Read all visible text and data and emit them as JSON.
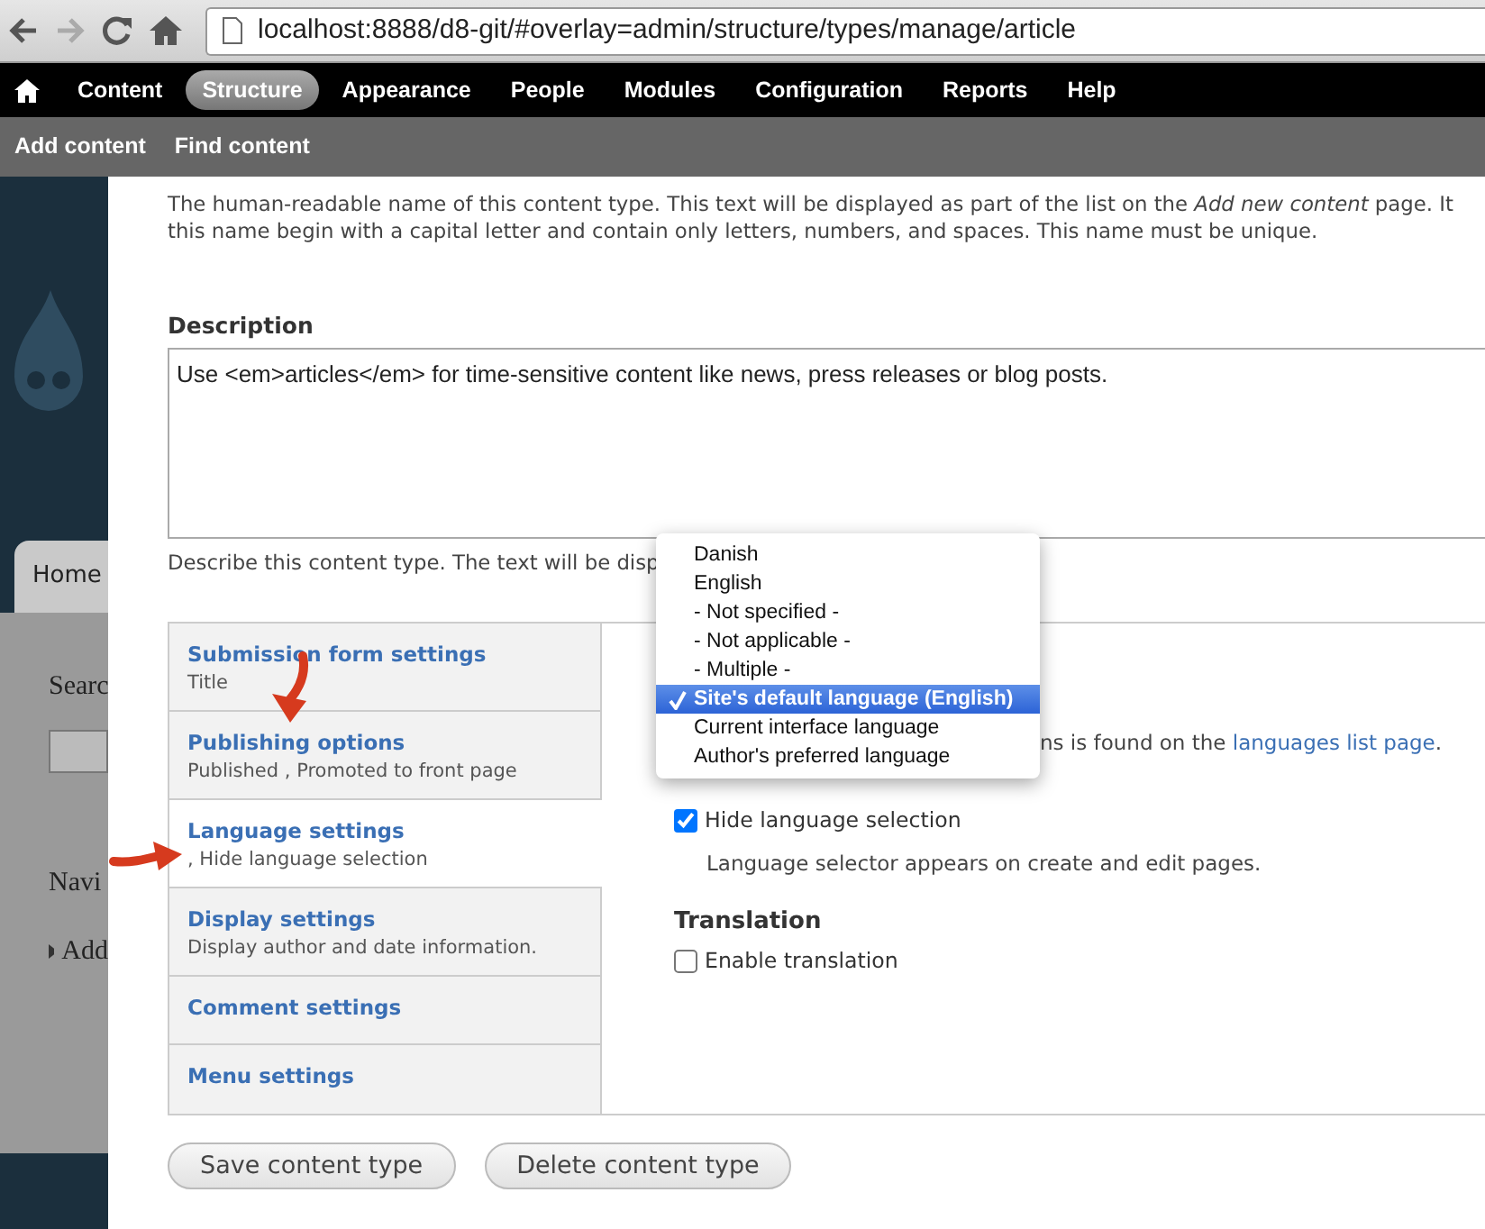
{
  "browser": {
    "url": "localhost:8888/d8-git/#overlay=admin/structure/types/manage/article"
  },
  "toolbar": [
    {
      "label": "Content",
      "selected": false
    },
    {
      "label": "Structure",
      "selected": true
    },
    {
      "label": "Appearance",
      "selected": false
    },
    {
      "label": "People",
      "selected": false
    },
    {
      "label": "Modules",
      "selected": false
    },
    {
      "label": "Configuration",
      "selected": false
    },
    {
      "label": "Reports",
      "selected": false
    },
    {
      "label": "Help",
      "selected": false
    }
  ],
  "shortcuts": [
    "Add content",
    "Find content"
  ],
  "background": {
    "tab": "Home",
    "block_1": "Searc",
    "block_2": "Navi",
    "link": "Add"
  },
  "name_help": [
    "The human-readable name of this content type. This text will be displayed as part of the list on the *Add new content* page. It",
    "this name begin with a capital letter and contain only letters, numbers, and spaces. This name must be unique."
  ],
  "description": {
    "label": "Description",
    "value": "Use <em>articles</em> for time-sensitive content like news, press releases or blog posts.",
    "help": "Describe this content type. The text will be disp"
  },
  "vertical_tabs": [
    {
      "title": "Submission form settings",
      "summary": "Title",
      "selected": false
    },
    {
      "title": "Publishing options",
      "summary": "Published , Promoted to front page",
      "selected": false
    },
    {
      "title": "Language settings",
      "summary": ", Hide language selection",
      "selected": true
    },
    {
      "title": "Display settings",
      "summary": "Display author and date information.",
      "selected": false
    },
    {
      "title": "Comment settings",
      "selected": false
    },
    {
      "title": "Menu settings",
      "selected": false
    }
  ],
  "language": {
    "menu": [
      {
        "label": "Danish",
        "selected": false
      },
      {
        "label": "English",
        "selected": false
      },
      {
        "label": "- Not specified -",
        "selected": false
      },
      {
        "label": "- Not applicable -",
        "selected": false
      },
      {
        "label": "- Multiple -",
        "selected": false
      },
      {
        "label": "Site's default language (English)",
        "selected": true
      },
      {
        "label": "Current interface language",
        "selected": false
      },
      {
        "label": "Author's preferred language",
        "selected": false
      }
    ],
    "note": "ns is found on the",
    "note_link": "languages list page",
    "note_end": ".",
    "hide": {
      "label": "Hide language selection",
      "checked": true
    },
    "hide_help": "Language selector appears on create and edit pages."
  },
  "translation": {
    "title": "Translation",
    "checkbox": {
      "label": "Enable translation",
      "checked": false
    }
  },
  "buttons": [
    "Save content type",
    "Delete content type"
  ]
}
